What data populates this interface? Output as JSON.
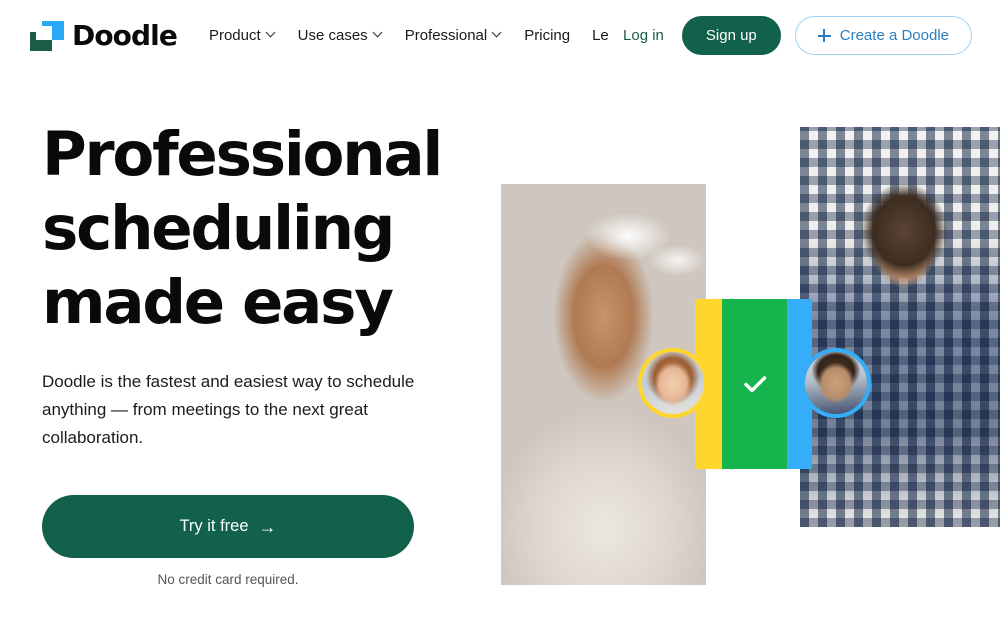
{
  "brand": {
    "name": "Doodle",
    "logo_icon": "doodle-squares-logo",
    "colors": {
      "green": "#12614a",
      "logo_blue": "#29A9F5",
      "logo_green": "#1A5C44",
      "accent_blue": "#35AEF7",
      "accent_yellow": "#FFD62E",
      "accent_green": "#17B44E"
    }
  },
  "nav": {
    "links": [
      {
        "label": "Product",
        "has_dropdown": true
      },
      {
        "label": "Use cases",
        "has_dropdown": true
      },
      {
        "label": "Professional",
        "has_dropdown": true
      },
      {
        "label": "Pricing",
        "has_dropdown": false
      },
      {
        "label": "Le",
        "has_dropdown": false
      }
    ],
    "login_label": "Log in",
    "signup_label": "Sign up",
    "create_label": "Create a Doodle",
    "create_icon": "plus-icon"
  },
  "hero": {
    "headline": "Professional scheduling made easy",
    "subhead": "Doodle is the fastest and easiest way to schedule anything — from meetings to the next great collaboration.",
    "cta_label": "Try it free",
    "cta_arrow": "→",
    "cta_note": "No credit card required."
  },
  "media": {
    "photo_left_alt": "Woman with glasses holding a tablet in an office",
    "photo_right_alt": "Man in plaid shirt working at a desk with a laptop",
    "avatar_left_alt": "Avatar of woman with glasses",
    "avatar_right_alt": "Avatar of man smiling",
    "check_icon": "checkmark-icon",
    "bars": [
      {
        "name": "bar-yellow",
        "color": "#FFD62E"
      },
      {
        "name": "bar-green",
        "color": "#17B44E"
      },
      {
        "name": "bar-blue",
        "color": "#35AEF7"
      }
    ]
  }
}
